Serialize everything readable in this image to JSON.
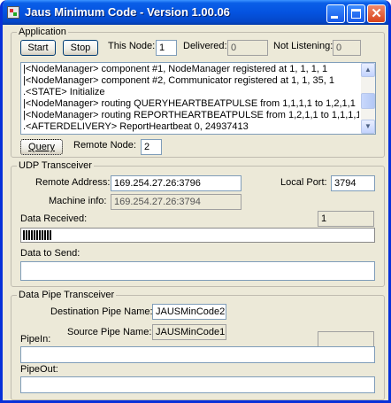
{
  "window": {
    "title": "Jaus Minimum Code - Version 1.00.06"
  },
  "application": {
    "legend": "Application",
    "start_label": "Start",
    "stop_label": "Stop",
    "this_node_label": "This Node:",
    "this_node_value": "1",
    "delivered_label": "Delivered:",
    "delivered_value": "0",
    "not_listening_label": "Not Listening:",
    "not_listening_value": "0",
    "log": [
      "|<NodeManager> component #1, NodeManager registered at 1, 1, 1, 1",
      "|<NodeManager> component #2, Communicator registered at 1, 1, 35, 1",
      ".<STATE> Initialize",
      "|<NodeManager> routing QUERYHEARTBEATPULSE from 1,1,1,1 to 1,2,1,1",
      "|<NodeManager> routing REPORTHEARTBEATPULSE from 1,2,1,1 to 1,1,1,1",
      ".<AFTERDELIVERY> ReportHeartbeat 0, 24937413"
    ],
    "query_label": "Query",
    "remote_node_label": "Remote Node:",
    "remote_node_value": "2"
  },
  "udp": {
    "legend": "UDP Transceiver",
    "remote_address_label": "Remote Address:",
    "remote_address_value": "169.254.27.26:3796",
    "local_port_label": "Local Port:",
    "local_port_value": "3794",
    "machine_info_label": "Machine info:",
    "machine_info_value": "169.254.27.26:3794",
    "data_received_label": "Data Received:",
    "data_received_count": "1",
    "received_fill_fraction": 0.08,
    "data_to_send_label": "Data to Send:",
    "data_to_send_value": ""
  },
  "pipe": {
    "legend": "Data Pipe Transceiver",
    "destination_label": "Destination Pipe Name:",
    "destination_value": "JAUSMinCode2",
    "source_label": "Source Pipe Name:",
    "source_value": "JAUSMinCode1",
    "pipein_label": "PipeIn:",
    "pipein_value": "",
    "pipein_count": "",
    "pipeout_label": "PipeOut:",
    "pipeout_value": ""
  }
}
